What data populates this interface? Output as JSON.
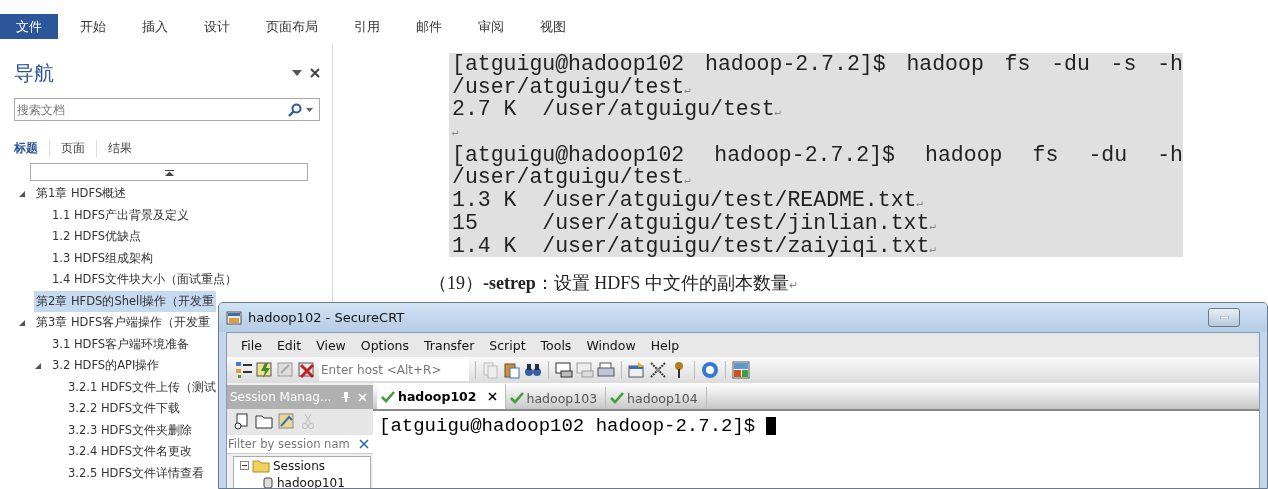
{
  "word_ribbon": {
    "tabs": [
      {
        "label": "文件",
        "selected": true
      },
      {
        "label": "开始",
        "selected": false
      },
      {
        "label": "插入",
        "selected": false
      },
      {
        "label": "设计",
        "selected": false
      },
      {
        "label": "页面布局",
        "selected": false
      },
      {
        "label": "引用",
        "selected": false
      },
      {
        "label": "邮件",
        "selected": false
      },
      {
        "label": "审阅",
        "selected": false
      },
      {
        "label": "视图",
        "selected": false
      }
    ]
  },
  "navigation": {
    "title": "导航",
    "search": {
      "placeholder": "搜索文档"
    },
    "tabs": [
      {
        "label": "标题",
        "selected": true
      },
      {
        "label": "页面",
        "selected": false
      },
      {
        "label": "结果",
        "selected": false
      }
    ],
    "tree": [
      {
        "label": "第1章 HDFS概述",
        "selected": false,
        "expanded": true,
        "children": [
          {
            "label": "1.1 HDFS产出背景及定义",
            "selected": false
          },
          {
            "label": "1.2 HDFS优缺点",
            "selected": false
          },
          {
            "label": "1.3 HDFS组成架构",
            "selected": false
          },
          {
            "label": "1.4 HDFS文件块大小（面试重点）",
            "selected": false
          }
        ]
      },
      {
        "label": "第2章 HFDS的Shell操作（开发重",
        "selected": true
      },
      {
        "label": "第3章 HDFS客户端操作（开发重",
        "selected": false,
        "expanded": true,
        "children": [
          {
            "label": "3.1 HDFS客户端环境准备",
            "selected": false
          },
          {
            "label": "3.2 HDFS的API操作",
            "selected": false,
            "expanded": true,
            "children": [
              {
                "label": "3.2.1 HDFS文件上传（测试",
                "selected": false
              },
              {
                "label": "3.2.2 HDFS文件下载",
                "selected": false
              },
              {
                "label": "3.2.3 HDFS文件夹删除",
                "selected": false
              },
              {
                "label": "3.2.4 HDFS文件名更改",
                "selected": false
              },
              {
                "label": "3.2.5 HDFS文件详情查看",
                "selected": false
              }
            ]
          }
        ]
      }
    ]
  },
  "document": {
    "code_lines": [
      {
        "text": "[atguigu@hadoop102 hadoop-2.7.2]$ hadoop fs -du -s -h",
        "soft_wrap": true
      },
      {
        "text": "/user/atguigu/test",
        "end_mark": "↵"
      },
      {
        "text": "2.7 K  /user/atguigu/test",
        "end_mark": "↵"
      },
      {
        "end_mark": "↵"
      },
      {
        "text": "[atguigu@hadoop102 hadoop-2.7.2]$ hadoop fs -du   -h",
        "soft_wrap": true
      },
      {
        "text": "/user/atguigu/test",
        "end_mark": "↵"
      },
      {
        "text": "1.3 K  /user/atguigu/test/README.txt",
        "end_mark": "↵"
      },
      {
        "text": "15     /user/atguigu/test/jinlian.txt",
        "end_mark": "↵"
      },
      {
        "text": "1.4 K  /user/atguigu/test/zaiyiqi.txt",
        "end_mark": "↵"
      }
    ],
    "paragraph": {
      "text": "（19）**-setrep**：设置 HDFS 中文件的副本数量",
      "end_mark": "↵"
    }
  },
  "securecrt": {
    "title": "hadoop102 - SecureCRT",
    "menu": [
      "File",
      "Edit",
      "View",
      "Options",
      "Transfer",
      "Script",
      "Tools",
      "Window",
      "Help"
    ],
    "host_field": {
      "placeholder": "Enter host <Alt+R>"
    },
    "session_manager": {
      "title": "Session Manag...",
      "filter": {
        "placeholder": "Filter by session nam"
      },
      "tree": [
        {
          "label": "Sessions",
          "expanded": true,
          "children": [
            {
              "label": "hadoop101"
            }
          ]
        }
      ]
    },
    "tabs": [
      {
        "label": "hadoop102",
        "selected": true
      },
      {
        "label": "hadoop103",
        "selected": false
      },
      {
        "label": "hadoop104",
        "selected": false
      }
    ],
    "terminal": {
      "prompt": "[atguigu@hadoop102 hadoop-2.7.2]$"
    }
  }
}
